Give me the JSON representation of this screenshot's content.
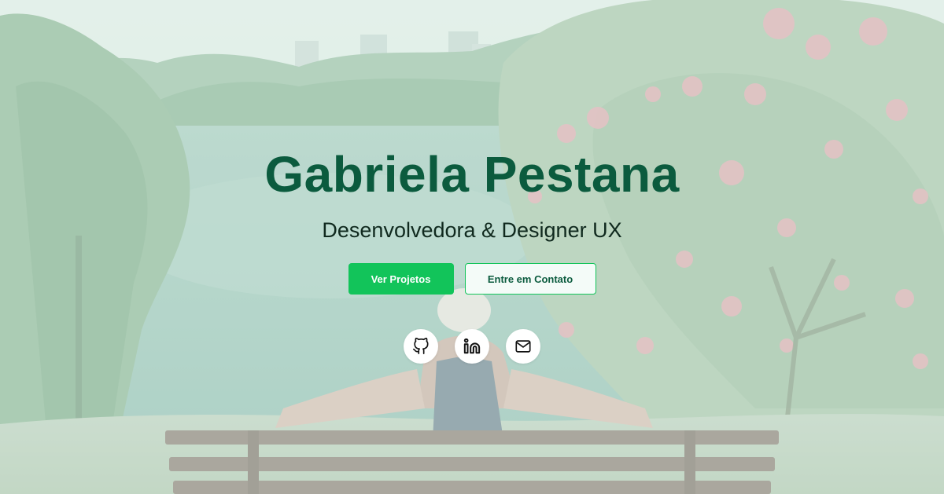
{
  "hero": {
    "name": "Gabriela Pestana",
    "role": "Desenvolvedora & Designer UX",
    "primary_button": "Ver Projetos",
    "secondary_button": "Entre em Contato"
  },
  "socials": [
    {
      "icon": "github-icon"
    },
    {
      "icon": "linkedin-icon"
    },
    {
      "icon": "mail-icon"
    }
  ],
  "colors": {
    "title": "#0b5b3e",
    "subtitle": "#10291e",
    "primary": "#12c45a",
    "secondary_border": "#12c45a",
    "secondary_text": "#0b5b3e",
    "icon": "#111111"
  }
}
